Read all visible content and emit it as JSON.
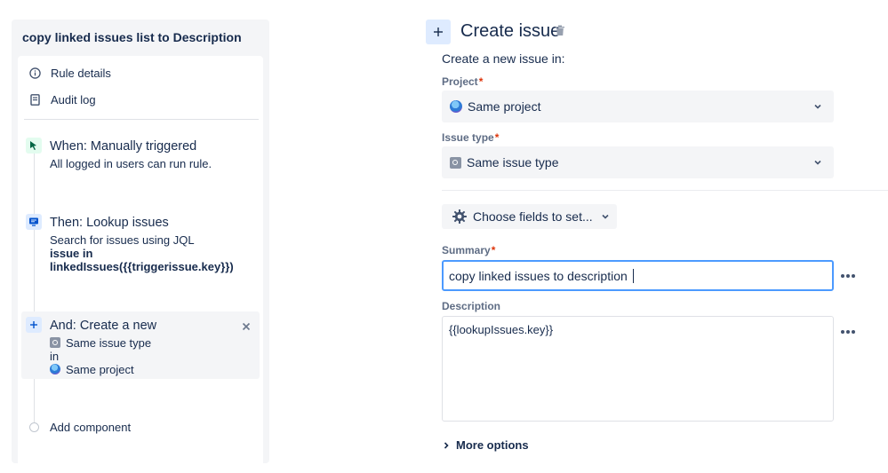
{
  "rule": {
    "title": "copy linked issues list to Description"
  },
  "nav": {
    "rule_details": "Rule details",
    "audit_log": "Audit log"
  },
  "trigger": {
    "title": "When: Manually triggered",
    "text": "All logged in users can run rule."
  },
  "lookup": {
    "title": "Then: Lookup issues",
    "text": "Search for issues using JQL",
    "jql_line1": "issue in",
    "jql_line2": "linkedIssues({{triggerissue.key}})"
  },
  "create_action": {
    "title": "And: Create a new",
    "issue_type": "Same issue type",
    "in_text": "in",
    "project": "Same project"
  },
  "add_component": "Add component",
  "form": {
    "header_title": "Create issue",
    "create_in_text": "Create a new issue in:",
    "project_label": "Project",
    "project_value": "Same project",
    "issue_type_label": "Issue type",
    "issue_type_value": "Same issue type",
    "choose_fields_label": "Choose fields to set...",
    "summary_label": "Summary",
    "summary_value": "copy linked issues to description",
    "description_label": "Description",
    "description_value": "{{lookupIssues.key}}",
    "more_options": "More options",
    "required_mark": "*"
  },
  "icons": {
    "add": "plus-icon",
    "delete": "trash-icon",
    "info": "info-icon",
    "audit": "document-icon",
    "trigger": "cursor-icon",
    "lookup": "monitor-icon",
    "settings": "gear-icon",
    "more": "more-horizontal-icon",
    "remove": "close-icon"
  },
  "colors": {
    "accent": "#0052cc",
    "focus_border": "#4c9aff",
    "required": "#de350b",
    "trigger_bg": "#e3fcef",
    "lookup_bg": "#deebff"
  }
}
